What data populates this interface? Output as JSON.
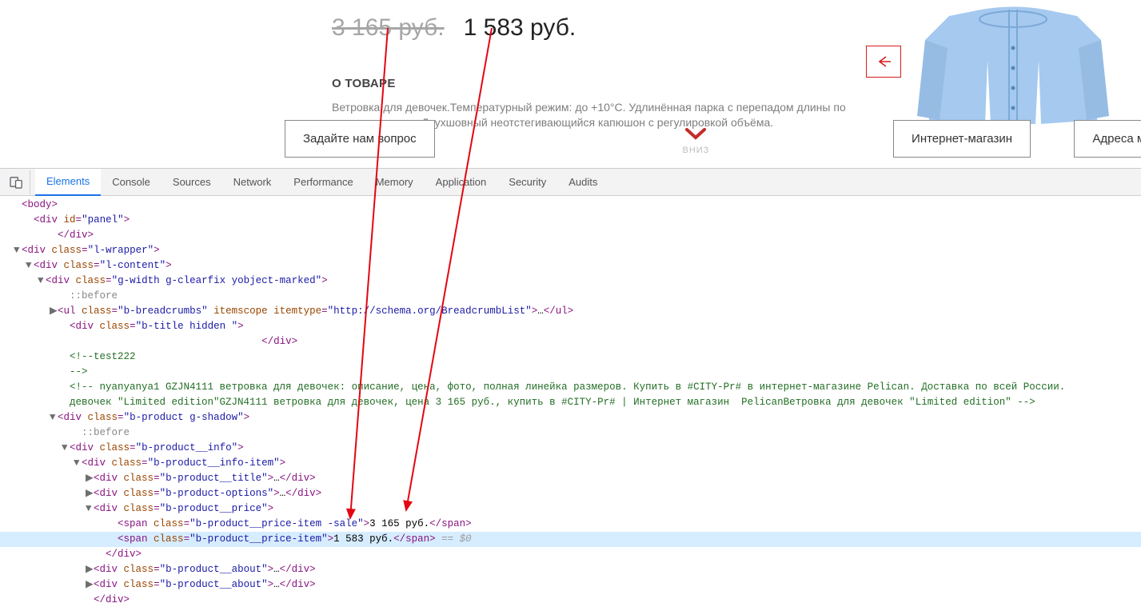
{
  "product": {
    "old_price": "3 165 руб.",
    "new_price": "1 583 руб.",
    "about_title": "О ТОВАРЕ",
    "about_text": "Ветровка для девочек.Температурный режим:   до +10°С.  Удлинённая парка с перепадом длины по спинке и переду. Двухшовный неотстегивающийся капюшон с регулировкой объёма."
  },
  "vniz_label": "ВНИЗ",
  "buttons": {
    "ask": "Задайте нам вопрос",
    "shop": "Интернет-магазин",
    "addresses": "Адреса мага"
  },
  "devtools": {
    "tabs": [
      "Elements",
      "Console",
      "Sources",
      "Network",
      "Performance",
      "Memory",
      "Application",
      "Security",
      "Audits"
    ],
    "active_tab": "Elements"
  },
  "lines": [
    {
      "indent": 0,
      "arrow": "",
      "parts": [
        {
          "t": "tag",
          "v": "<body>"
        }
      ]
    },
    {
      "indent": 1,
      "arrow": "",
      "parts": [
        {
          "t": "tag",
          "v": "<div "
        },
        {
          "t": "attr",
          "v": "id"
        },
        {
          "t": "tag",
          "v": "="
        },
        {
          "t": "val",
          "v": "\"panel\""
        },
        {
          "t": "tag",
          "v": ">"
        }
      ]
    },
    {
      "indent": 3,
      "arrow": "",
      "parts": [
        {
          "t": "tag",
          "v": "</div>"
        }
      ]
    },
    {
      "indent": 0,
      "arrow": "▼",
      "parts": [
        {
          "t": "tag",
          "v": "<div "
        },
        {
          "t": "attr",
          "v": "class"
        },
        {
          "t": "tag",
          "v": "="
        },
        {
          "t": "val",
          "v": "\"l-wrapper\""
        },
        {
          "t": "tag",
          "v": ">"
        }
      ]
    },
    {
      "indent": 1,
      "arrow": "▼",
      "parts": [
        {
          "t": "tag",
          "v": "<div "
        },
        {
          "t": "attr",
          "v": "class"
        },
        {
          "t": "tag",
          "v": "="
        },
        {
          "t": "val",
          "v": "\"l-content\""
        },
        {
          "t": "tag",
          "v": ">"
        }
      ]
    },
    {
      "indent": 2,
      "arrow": "▼",
      "parts": [
        {
          "t": "tag",
          "v": "<div "
        },
        {
          "t": "attr",
          "v": "class"
        },
        {
          "t": "tag",
          "v": "="
        },
        {
          "t": "val",
          "v": "\"g-width g-clearfix yobject-marked\""
        },
        {
          "t": "tag",
          "v": ">"
        }
      ]
    },
    {
      "indent": 4,
      "arrow": "",
      "parts": [
        {
          "t": "pseudo",
          "v": "::before"
        }
      ]
    },
    {
      "indent": 3,
      "arrow": "▶",
      "parts": [
        {
          "t": "tag",
          "v": "<ul "
        },
        {
          "t": "attr",
          "v": "class"
        },
        {
          "t": "tag",
          "v": "="
        },
        {
          "t": "val",
          "v": "\"b-breadcrumbs\""
        },
        {
          "t": "tag",
          "v": " "
        },
        {
          "t": "attr",
          "v": "itemscope itemtype"
        },
        {
          "t": "tag",
          "v": "="
        },
        {
          "t": "val",
          "v": "\"http://schema.org/BreadcrumbList\""
        },
        {
          "t": "tag",
          "v": ">"
        },
        {
          "t": "txt",
          "v": "…"
        },
        {
          "t": "tag",
          "v": "</ul>"
        }
      ]
    },
    {
      "indent": 4,
      "arrow": "",
      "parts": [
        {
          "t": "tag",
          "v": "<div "
        },
        {
          "t": "attr",
          "v": "class"
        },
        {
          "t": "tag",
          "v": "="
        },
        {
          "t": "val",
          "v": "\"b-title hidden \""
        },
        {
          "t": "tag",
          "v": ">"
        }
      ]
    },
    {
      "indent": 20,
      "arrow": "",
      "parts": [
        {
          "t": "tag",
          "v": "</div>"
        }
      ]
    },
    {
      "indent": 4,
      "arrow": "",
      "parts": [
        {
          "t": "comment",
          "v": "<!--test222"
        }
      ]
    },
    {
      "indent": 4,
      "arrow": "",
      "parts": [
        {
          "t": "comment",
          "v": "-->"
        }
      ]
    },
    {
      "indent": 4,
      "arrow": "",
      "parts": [
        {
          "t": "comment",
          "v": "<!-- nyanyanya1 GZJN4111 ветровка для девочек: описание, цена, фото, полная линейка размеров. Купить в #CITY-Pr# в интернет-магазине Pelican. Доставка по всей России."
        }
      ]
    },
    {
      "indent": 4,
      "arrow": "",
      "parts": [
        {
          "t": "comment",
          "v": "девочек \"Limited edition\"GZJN4111 ветровка для девочек, цена 3 165 руб., купить в #CITY-Pr# | Интернет магазин  PelicanВетровка для девочек \"Limited edition\" -->"
        }
      ]
    },
    {
      "indent": 3,
      "arrow": "▼",
      "parts": [
        {
          "t": "tag",
          "v": "<div "
        },
        {
          "t": "attr",
          "v": "class"
        },
        {
          "t": "tag",
          "v": "="
        },
        {
          "t": "val",
          "v": "\"b-product g-shadow\""
        },
        {
          "t": "tag",
          "v": ">"
        }
      ]
    },
    {
      "indent": 5,
      "arrow": "",
      "parts": [
        {
          "t": "pseudo",
          "v": "::before"
        }
      ]
    },
    {
      "indent": 4,
      "arrow": "▼",
      "parts": [
        {
          "t": "tag",
          "v": "<div "
        },
        {
          "t": "attr",
          "v": "class"
        },
        {
          "t": "tag",
          "v": "="
        },
        {
          "t": "val",
          "v": "\"b-product__info\""
        },
        {
          "t": "tag",
          "v": ">"
        }
      ]
    },
    {
      "indent": 5,
      "arrow": "▼",
      "parts": [
        {
          "t": "tag",
          "v": "<div "
        },
        {
          "t": "attr",
          "v": "class"
        },
        {
          "t": "tag",
          "v": "="
        },
        {
          "t": "val",
          "v": "\"b-product__info-item\""
        },
        {
          "t": "tag",
          "v": ">"
        }
      ]
    },
    {
      "indent": 6,
      "arrow": "▶",
      "parts": [
        {
          "t": "tag",
          "v": "<div "
        },
        {
          "t": "attr",
          "v": "class"
        },
        {
          "t": "tag",
          "v": "="
        },
        {
          "t": "val",
          "v": "\"b-product__title\""
        },
        {
          "t": "tag",
          "v": ">"
        },
        {
          "t": "txt",
          "v": "…"
        },
        {
          "t": "tag",
          "v": "</div>"
        }
      ]
    },
    {
      "indent": 6,
      "arrow": "▶",
      "parts": [
        {
          "t": "tag",
          "v": "<div "
        },
        {
          "t": "attr",
          "v": "class"
        },
        {
          "t": "tag",
          "v": "="
        },
        {
          "t": "val",
          "v": "\"b-product-options\""
        },
        {
          "t": "tag",
          "v": ">"
        },
        {
          "t": "txt",
          "v": "…"
        },
        {
          "t": "tag",
          "v": "</div>"
        }
      ]
    },
    {
      "indent": 6,
      "arrow": "▼",
      "parts": [
        {
          "t": "tag",
          "v": "<div "
        },
        {
          "t": "attr",
          "v": "class"
        },
        {
          "t": "tag",
          "v": "="
        },
        {
          "t": "val",
          "v": "\"b-product__price\""
        },
        {
          "t": "tag",
          "v": ">"
        }
      ]
    },
    {
      "indent": 8,
      "arrow": "",
      "parts": [
        {
          "t": "tag",
          "v": "<span "
        },
        {
          "t": "attr",
          "v": "class"
        },
        {
          "t": "tag",
          "v": "="
        },
        {
          "t": "val",
          "v": "\"b-product__price-item -sale\""
        },
        {
          "t": "tag",
          "v": ">"
        },
        {
          "t": "txt",
          "v": "3 165 руб."
        },
        {
          "t": "tag",
          "v": "</span>"
        }
      ]
    },
    {
      "indent": 8,
      "arrow": "",
      "hl": true,
      "parts": [
        {
          "t": "tag",
          "v": "<span "
        },
        {
          "t": "attr",
          "v": "class"
        },
        {
          "t": "tag",
          "v": "="
        },
        {
          "t": "val",
          "v": "\"b-product__price-item\""
        },
        {
          "t": "tag",
          "v": ">"
        },
        {
          "t": "txt",
          "v": "1 583 руб."
        },
        {
          "t": "tag",
          "v": "</span>"
        },
        {
          "t": "marker",
          "v": " == $0"
        }
      ]
    },
    {
      "indent": 7,
      "arrow": "",
      "parts": [
        {
          "t": "tag",
          "v": "</div>"
        }
      ]
    },
    {
      "indent": 6,
      "arrow": "▶",
      "parts": [
        {
          "t": "tag",
          "v": "<div "
        },
        {
          "t": "attr",
          "v": "class"
        },
        {
          "t": "tag",
          "v": "="
        },
        {
          "t": "val",
          "v": "\"b-product__about\""
        },
        {
          "t": "tag",
          "v": ">"
        },
        {
          "t": "txt",
          "v": "…"
        },
        {
          "t": "tag",
          "v": "</div>"
        }
      ]
    },
    {
      "indent": 6,
      "arrow": "▶",
      "parts": [
        {
          "t": "tag",
          "v": "<div "
        },
        {
          "t": "attr",
          "v": "class"
        },
        {
          "t": "tag",
          "v": "="
        },
        {
          "t": "val",
          "v": "\"b-product__about\""
        },
        {
          "t": "tag",
          "v": ">"
        },
        {
          "t": "txt",
          "v": "…"
        },
        {
          "t": "tag",
          "v": "</div>"
        }
      ]
    },
    {
      "indent": 6,
      "arrow": "",
      "parts": [
        {
          "t": "tag",
          "v": "</div>"
        }
      ]
    }
  ]
}
